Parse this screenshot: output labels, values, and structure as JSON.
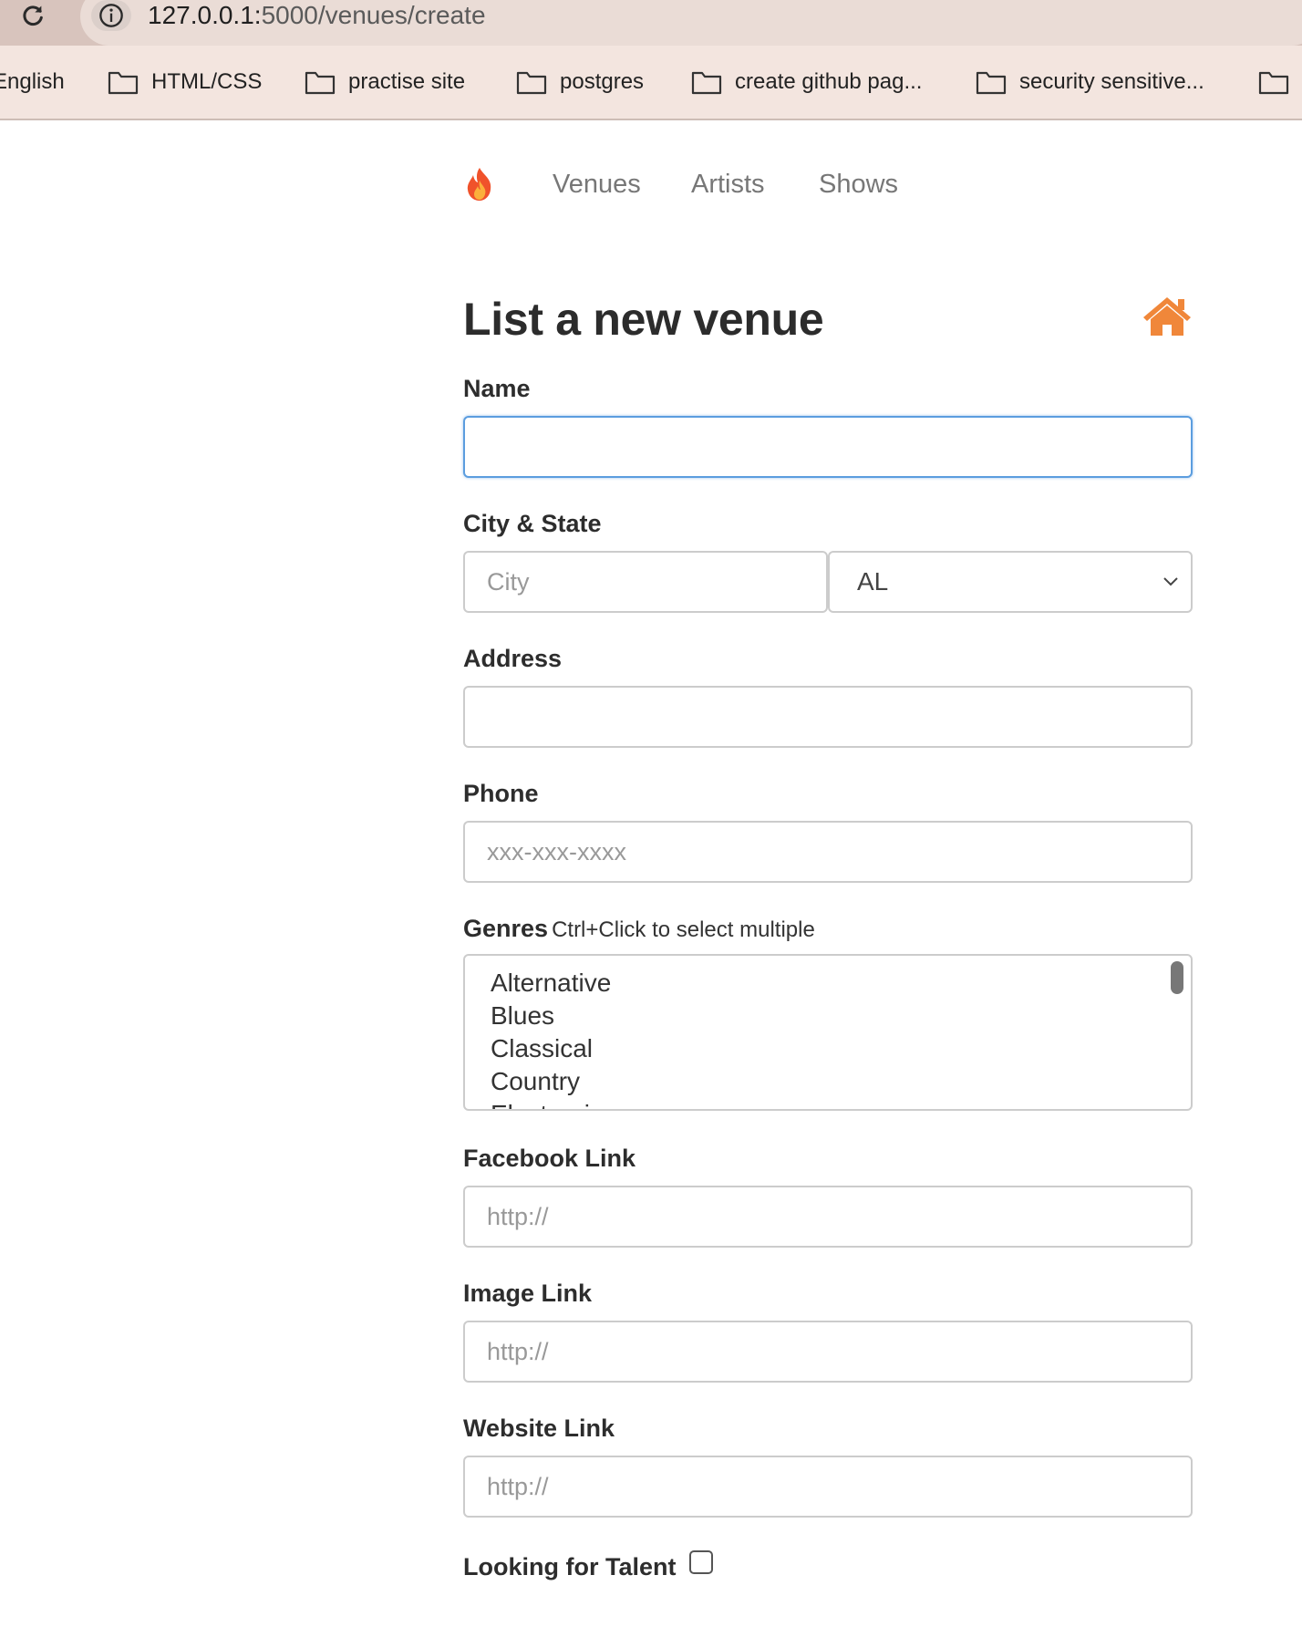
{
  "browser": {
    "url_host": "127.0.0.1:",
    "url_path": "5000/venues/create",
    "bookmarks": [
      "English",
      "HTML/CSS",
      "practise site",
      "postgres",
      "create github pag...",
      "security sensitive..."
    ]
  },
  "nav": {
    "links": [
      "Venues",
      "Artists",
      "Shows"
    ]
  },
  "page": {
    "title": "List a new venue"
  },
  "form": {
    "name_label": "Name",
    "name_value": "",
    "city_state_label": "City & State",
    "city_placeholder": "City",
    "state_selected": "AL",
    "address_label": "Address",
    "address_value": "",
    "phone_label": "Phone",
    "phone_placeholder": "xxx-xxx-xxxx",
    "genres_label": "Genres",
    "genres_hint": "Ctrl+Click to select multiple",
    "genres_options": [
      "Alternative",
      "Blues",
      "Classical",
      "Country",
      "Electronic"
    ],
    "facebook_label": "Facebook Link",
    "facebook_placeholder": "http://",
    "image_label": "Image Link",
    "image_placeholder": "http://",
    "website_label": "Website Link",
    "website_placeholder": "http://",
    "talent_label": "Looking for Talent"
  },
  "colors": {
    "accent": "#f0873a",
    "focus": "#5b9ddf",
    "chrome": "#d8c4bd",
    "bookmarks_bar": "#f3e5df"
  },
  "icons": {
    "nav_logo": "fire-icon",
    "title_icon": "home-icon",
    "bookmark_folder": "folder-icon"
  }
}
